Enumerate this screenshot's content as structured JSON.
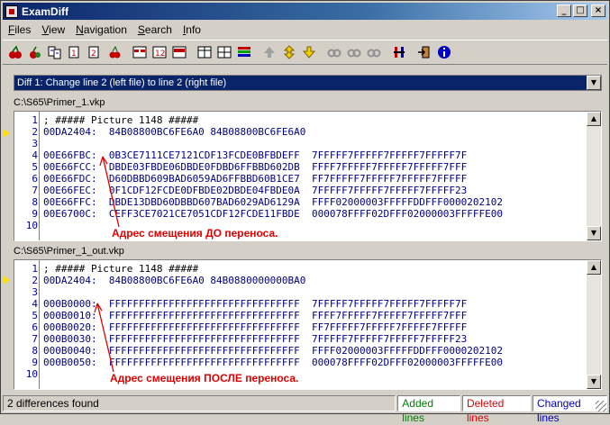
{
  "window": {
    "title": "ExamDiff"
  },
  "menu": [
    {
      "label": "Files",
      "u": "F",
      "rest": "iles"
    },
    {
      "label": "View",
      "u": "V",
      "rest": "iew"
    },
    {
      "label": "Navigation",
      "u": "N",
      "rest": "avigation"
    },
    {
      "label": "Search",
      "u": "S",
      "rest": "earch"
    },
    {
      "label": "Info",
      "u": "I",
      "rest": "nfo"
    }
  ],
  "diff_selector": {
    "value": "Diff 1: Change line 2 (left file) to line 2 (right file)"
  },
  "left_pane": {
    "path": "C:\\S65\\Primer_1.vkp",
    "lines": [
      {
        "num": "1",
        "text": "; ##### Picture 1148 #####"
      },
      {
        "num": "2",
        "text": "00DA2404:  84B08800BC6FE6A0 84B08800BC6FE6A0"
      },
      {
        "num": "3",
        "text": ""
      },
      {
        "num": "4",
        "text": "00E66FBC:  0B3CE7111CE7121CDF13FCDE0BFBDEFF  7FFFFF7FFFFF7FFFFF7FFFFF7F"
      },
      {
        "num": "5",
        "text": "00E66FCC:  DBDE03FBDE06DBDE0FDBD6FFBBD602DB  FFFF7FFFFF7FFFFF7FFFFF7FFF"
      },
      {
        "num": "6",
        "text": "00E66FDC:  D60DBBD609BAD6059AD6FFBBD60B1CE7  FF7FFFFF7FFFFF7FFFFF7FFFFF"
      },
      {
        "num": "7",
        "text": "00E66FEC:  0F1CDF12FCDE0DFBDE02DBDE04FBDE0A  7FFFFF7FFFFF7FFFFF7FFFFF23"
      },
      {
        "num": "8",
        "text": "00E66FFC:  DBDE13DBD60DBBD607BAD6029AD6129A  FFFF02000003FFFFFDDFFF0000202102"
      },
      {
        "num": "9",
        "text": "00E6700C:  CEFF3CE7021CE7051CDF12FCDE11FBDE  000078FFFF02DFFF02000003FFFFFE00"
      },
      {
        "num": "10",
        "text": ""
      }
    ],
    "annotation": "Адрес смещения ДО переноса."
  },
  "right_pane": {
    "path": "C:\\S65\\Primer_1_out.vkp",
    "lines": [
      {
        "num": "1",
        "text": "; ##### Picture 1148 #####"
      },
      {
        "num": "2",
        "text": "00DA2404:  84B08800BC6FE6A0 84B0880000000BA0"
      },
      {
        "num": "3",
        "text": ""
      },
      {
        "num": "4",
        "text": "000B0000:  FFFFFFFFFFFFFFFFFFFFFFFFFFFFFFFF  7FFFFF7FFFFF7FFFFF7FFFFF7F"
      },
      {
        "num": "5",
        "text": "000B0010:  FFFFFFFFFFFFFFFFFFFFFFFFFFFFFFFF  FFFF7FFFFF7FFFFF7FFFFF7FFF"
      },
      {
        "num": "6",
        "text": "000B0020:  FFFFFFFFFFFFFFFFFFFFFFFFFFFFFFFF  FF7FFFFF7FFFFF7FFFFF7FFFFF"
      },
      {
        "num": "7",
        "text": "000B0030:  FFFFFFFFFFFFFFFFFFFFFFFFFFFFFFFF  7FFFFF7FFFFF7FFFFF7FFFFF23"
      },
      {
        "num": "8",
        "text": "000B0040:  FFFFFFFFFFFFFFFFFFFFFFFFFFFFFFFF  FFFF02000003FFFFFDDFFF0000202102"
      },
      {
        "num": "9",
        "text": "000B0050:  FFFFFFFFFFFFFFFFFFFFFFFFFFFFFFFF  000078FFFF02DFFF02000003FFFFFE00"
      },
      {
        "num": "10",
        "text": ""
      }
    ],
    "annotation": "Адрес смещения ПОСЛЕ переноса."
  },
  "status": {
    "message": "2 differences found",
    "added": "Added lines",
    "deleted": "Deleted lines",
    "changed": "Changed lines"
  },
  "colors": {
    "added": "#008000",
    "deleted": "#e00000",
    "changed": "#0000c0",
    "selection": "#0a246a",
    "annotation": "#e00000"
  },
  "toolbar_icons": [
    "cherries-icon",
    "cherry-icon",
    "compare-files-icon",
    "edit-file-icon",
    "edit-second-file-icon",
    "recompare-icon",
    "show-diffs-1-icon",
    "show-diffs-2-icon",
    "show-diffs-3-icon",
    "split-vertical-icon",
    "split-horizontal-icon",
    "colors-icon",
    "first-diff-icon",
    "prev-diff-icon",
    "next-diff-icon",
    "find-icon",
    "find-next-icon",
    "find-prev-icon",
    "options-icon",
    "exit-icon",
    "info-icon"
  ]
}
